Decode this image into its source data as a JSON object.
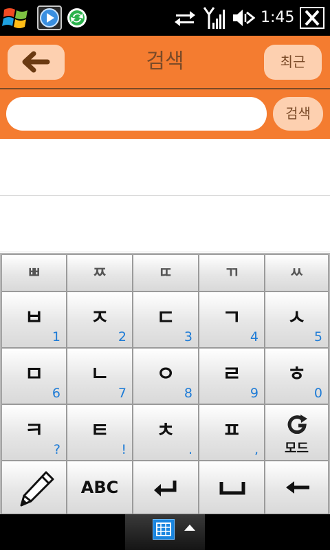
{
  "status_bar": {
    "time": "1:45"
  },
  "header": {
    "title": "검색",
    "recent_label": "최근"
  },
  "search": {
    "value": "",
    "placeholder": "",
    "button_label": "검색"
  },
  "keyboard": {
    "top_row": [
      "ㅃ",
      "ㅉ",
      "ㄸ",
      "ㄲ",
      "ㅆ"
    ],
    "rows": [
      [
        {
          "main": "ㅂ",
          "sub": "1"
        },
        {
          "main": "ㅈ",
          "sub": "2"
        },
        {
          "main": "ㄷ",
          "sub": "3"
        },
        {
          "main": "ㄱ",
          "sub": "4"
        },
        {
          "main": "ㅅ",
          "sub": "5"
        }
      ],
      [
        {
          "main": "ㅁ",
          "sub": "6"
        },
        {
          "main": "ㄴ",
          "sub": "7"
        },
        {
          "main": "ㅇ",
          "sub": "8"
        },
        {
          "main": "ㄹ",
          "sub": "9"
        },
        {
          "main": "ㅎ",
          "sub": "0"
        }
      ],
      [
        {
          "main": "ㅋ",
          "sub": "?"
        },
        {
          "main": "ㅌ",
          "sub": "!"
        },
        {
          "main": "ㅊ",
          "sub": "."
        },
        {
          "main": "ㅍ",
          "sub": ","
        },
        {
          "main": "",
          "sub": ""
        }
      ]
    ],
    "mode_label": "모드",
    "abc_label": "ABC"
  },
  "colors": {
    "accent": "#f47c30",
    "button_fill": "#fdd0b0",
    "button_text": "#7a4a28",
    "key_number": "#1d7bd6"
  }
}
